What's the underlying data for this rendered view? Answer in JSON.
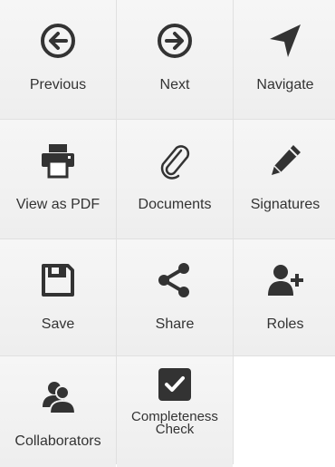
{
  "tiles": [
    {
      "label": "Previous",
      "icon": "arrow-left-circle-icon"
    },
    {
      "label": "Next",
      "icon": "arrow-right-circle-icon"
    },
    {
      "label": "Navigate",
      "icon": "location-arrow-icon"
    },
    {
      "label": "View as PDF",
      "icon": "printer-icon"
    },
    {
      "label": "Documents",
      "icon": "paperclip-icon"
    },
    {
      "label": "Signatures",
      "icon": "pencil-icon"
    },
    {
      "label": "Save",
      "icon": "floppy-disk-icon"
    },
    {
      "label": "Share",
      "icon": "share-icon"
    },
    {
      "label": "Roles",
      "icon": "user-add-icon"
    },
    {
      "label": "Collaborators",
      "icon": "users-icon"
    },
    {
      "label": "Completeness Check",
      "icon": "check-square-icon"
    }
  ],
  "colors": {
    "icon": "#333333",
    "tile_bg": "#f2f2f2",
    "divider": "#e0e0e0"
  }
}
